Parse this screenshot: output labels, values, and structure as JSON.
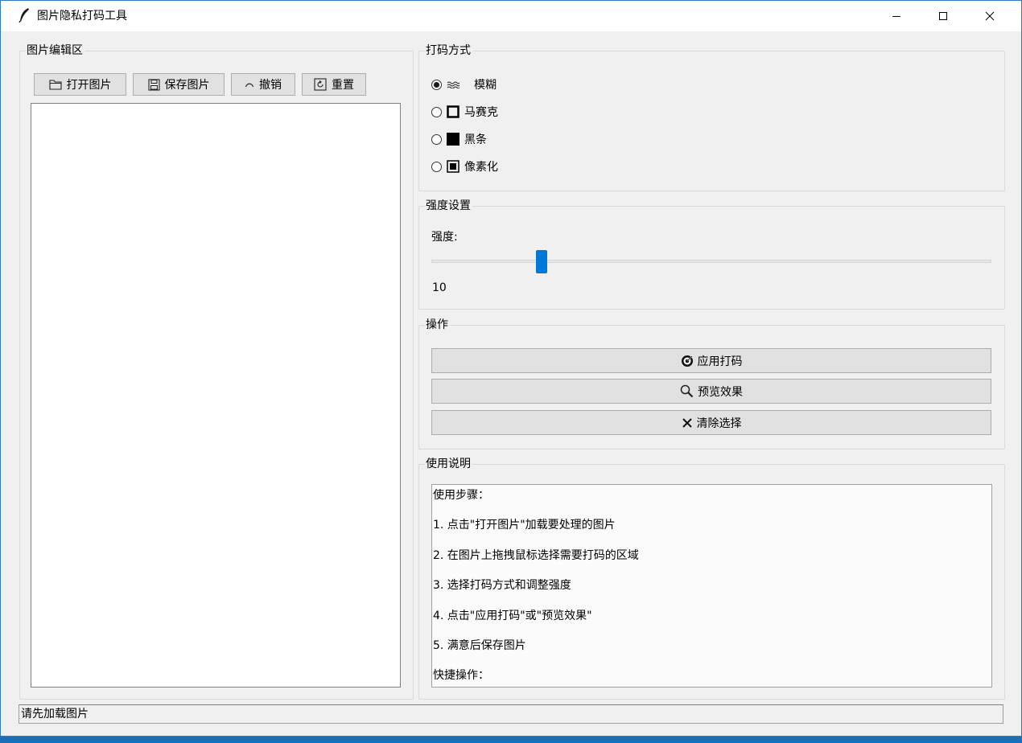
{
  "window": {
    "title": "图片隐私打码工具"
  },
  "editor": {
    "group_title": "图片编辑区",
    "toolbar": {
      "open_label": "打开图片",
      "save_label": "保存图片",
      "undo_label": "撤销",
      "reset_label": "重置"
    }
  },
  "mosaic_mode": {
    "group_title": "打码方式",
    "options": [
      {
        "label": "模糊",
        "icon": "blur-wave-icon",
        "selected": true
      },
      {
        "label": "马赛克",
        "icon": "square-outline-icon",
        "selected": false
      },
      {
        "label": "黑条",
        "icon": "black-square-icon",
        "selected": false
      },
      {
        "label": "像素化",
        "icon": "square-in-square-icon",
        "selected": false
      }
    ]
  },
  "strength": {
    "group_title": "强度设置",
    "label": "强度:",
    "value": "10",
    "slider_fraction": 0.19
  },
  "actions": {
    "group_title": "操作",
    "apply_label": "应用打码",
    "preview_label": "预览效果",
    "clear_label": "清除选择"
  },
  "help": {
    "group_title": "使用说明",
    "lines": [
      "使用步骤：",
      "1. 点击\"打开图片\"加载要处理的图片",
      "2. 在图片上拖拽鼠标选择需要打码的区域",
      "3. 选择打码方式和调整强度",
      "4. 点击\"应用打码\"或\"预览效果\"",
      "5. 满意后保存图片",
      "快捷操作："
    ]
  },
  "status": {
    "text": "请先加载图片"
  },
  "colors": {
    "accent": "#0078d7",
    "window_bg": "#f0f0f0"
  }
}
